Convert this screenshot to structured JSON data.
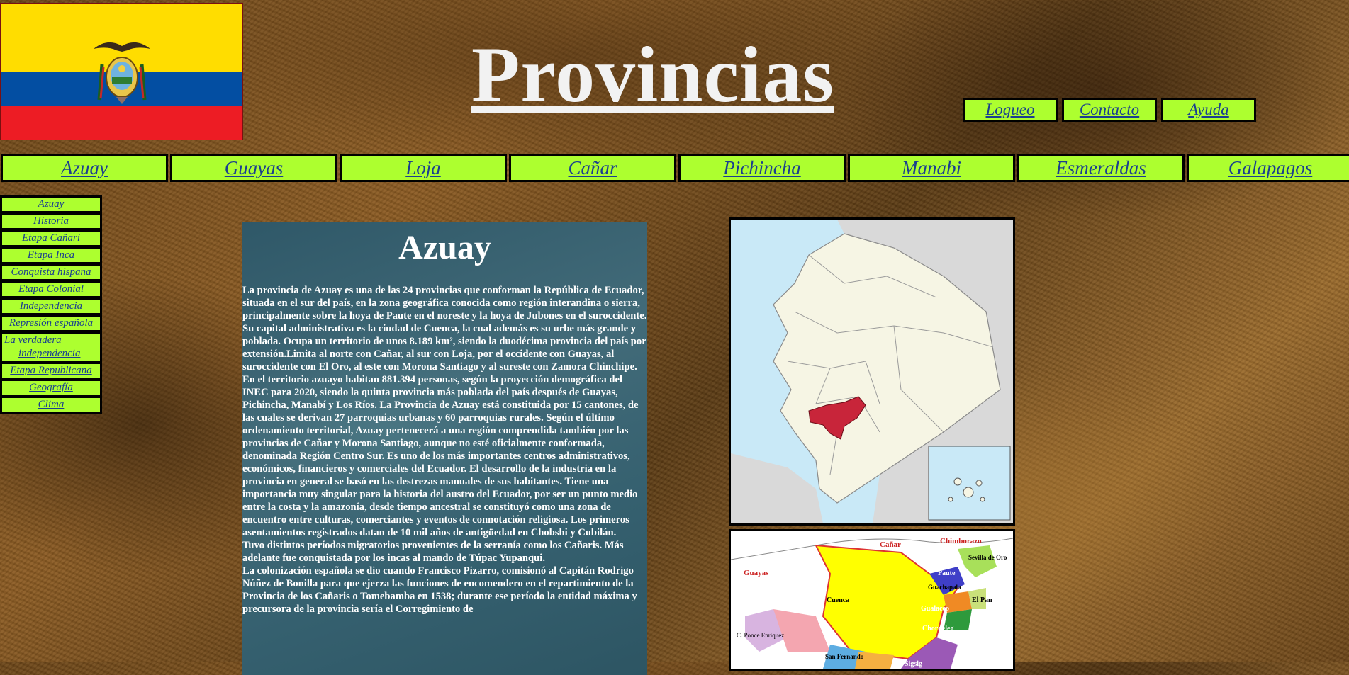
{
  "header": {
    "title": "Provincias"
  },
  "top_links": [
    {
      "label": "Logueo"
    },
    {
      "label": "Contacto"
    },
    {
      "label": "Ayuda"
    }
  ],
  "main_nav": [
    {
      "label": "Azuay"
    },
    {
      "label": "Guayas"
    },
    {
      "label": "Loja"
    },
    {
      "label": "Cañar"
    },
    {
      "label": "Pichincha"
    },
    {
      "label": "Manabi"
    },
    {
      "label": "Esmeraldas"
    },
    {
      "label": "Galapagos"
    }
  ],
  "side_nav": [
    {
      "label": "Azuay"
    },
    {
      "label": "Historia"
    },
    {
      "label": "Etapa Cañari"
    },
    {
      "label": "Etapa Inca"
    },
    {
      "label": "Conquista hispana"
    },
    {
      "label": "Etapa Colonial"
    },
    {
      "label": "Independencia"
    },
    {
      "label": "Represión española"
    },
    {
      "label_line1": "La verdadera",
      "label_line2": "independencia"
    },
    {
      "label": "Etapa Republicana"
    },
    {
      "label": "Geografía"
    },
    {
      "label": "Clima"
    }
  ],
  "article": {
    "heading": "Azuay",
    "paragraphs": [
      "La provincia de Azuay es una de las 24 provincias que conforman la República de Ecuador, situada en el sur del país, en la zona geográfica conocida como región interandina o sierra, principalmente sobre la hoya de Paute en el noreste y la hoya de Jubones en el suroccidente.",
      "Su capital administrativa es la ciudad de Cuenca, la cual además es su urbe más grande y poblada. Ocupa un territorio de unos 8.189 km², siendo la duodécima provincia del país por extensión.Limita al norte con Cañar, al sur con Loja, por el occidente con Guayas, al suroccidente con El Oro, al este con Morona Santiago y al sureste con Zamora Chinchipe.",
      "En el territorio azuayo habitan 881.394 personas, según la proyección demográfica del INEC para 2020, siendo la quinta provincia más poblada del país después de Guayas, Pichincha, Manabí y Los Ríos. La Provincia de Azuay está constituida por 15 cantones, de las cuales se derivan 27 parroquias urbanas y 60 parroquias rurales. Según el último ordenamiento territorial, Azuay pertenecerá a una región comprendida también por las provincias de Cañar y Morona Santiago, aunque no esté oficialmente conformada, denominada Región Centro Sur. Es uno de los más importantes centros administrativos, económicos, financieros y comerciales del Ecuador. El desarrollo de la industria en la provincia en general se basó en las destrezas manuales de sus habitantes. Tiene una importancia muy singular para la historia del austro del Ecuador, por ser un punto medio entre la costa y la amazonía, desde tiempo ancestral se constituyó como una zona de encuentro entre culturas, comerciantes y eventos de connotación religiosa. Los primeros asentamientos registrados datan de 10 mil años de antigüedad en Chobshi y Cubilán.",
      "Tuvo distintos períodos migratorios provenientes de la serranía como los Cañaris. Más adelante fue conquistada por los incas al mando de Túpac Yupanqui.",
      "La colonización española se dio cuando Francisco Pizarro, comisionó al Capitán Rodrigo Núñez de Bonilla para que ejerza las funciones de encomendero en el repartimiento de la Provincia de los Cañaris o Tomebamba en 1538; durante ese período la entidad máxima y precursora de la provincia sería el Corregimiento de"
    ]
  },
  "cantons_map": {
    "labels": {
      "canar": "Cañar",
      "chimborazo": "Chimborazo",
      "guayas": "Guayas",
      "sevilla": "Sevilla de Oro",
      "paute": "Paute",
      "guachapala": "Guachapala",
      "cuenca": "Cuenca",
      "el_pan": "El Pan",
      "gualaceo": "Gualaceo",
      "chordeleg": "Chordeleg",
      "ponce": "C. Ponce Enríquez",
      "san_fernando": "San Fernando",
      "sigsig": "Sigsig"
    }
  },
  "colors": {
    "nav_bg": "#adff2f",
    "link": "#1a3f8f",
    "azuay_highlight": "#c8253a",
    "content_bg": "#3a6676"
  }
}
